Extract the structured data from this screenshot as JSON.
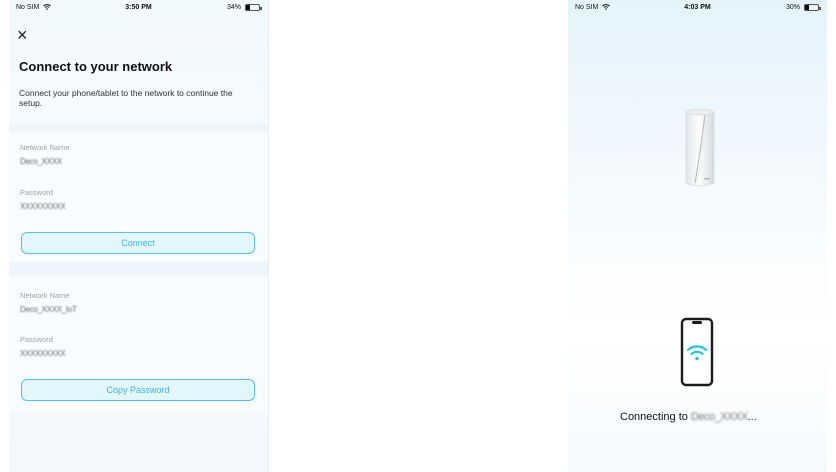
{
  "left_screen": {
    "status": {
      "carrier": "No SIM",
      "time": "3:50 PM",
      "battery": "34%",
      "battery_level": 0.34
    },
    "close_glyph": "×",
    "title": "Connect to your network",
    "subtitle": "Connect your phone/tablet to the network to continue the setup.",
    "network1": {
      "name_label": "Network Name",
      "name_value": "Deco_XXXX",
      "password_label": "Password",
      "password_value": "XXXXXXXXX",
      "button": "Connect"
    },
    "network2": {
      "name_label": "Network Name",
      "name_value": "Deco_XXXX_IoT",
      "password_label": "Password",
      "password_value": "XXXXXXXXX",
      "button": "Copy Password"
    }
  },
  "right_screen": {
    "status": {
      "carrier": "No SIM",
      "time": "4:03 PM",
      "battery": "30%",
      "battery_level": 0.3
    },
    "connecting_prefix": "Connecting to",
    "connecting_ssid": "Deco_XXXX",
    "connecting_suffix": "..."
  },
  "icons": {
    "close": "close-icon",
    "wifi": "wifi-icon",
    "router": "deco-router-icon",
    "phone": "phone-icon"
  },
  "colors": {
    "accent": "#38b6e2",
    "button_bg": "#e3f6fc",
    "wifi_accent": "#1fc3e0"
  }
}
